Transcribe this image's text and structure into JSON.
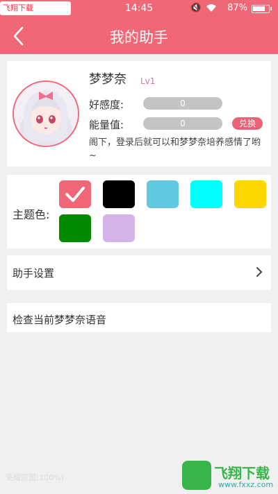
{
  "status_bar": {
    "watermark": "飞翔下载 www.FXXZ.com",
    "time": "14:45",
    "battery_percent": "87%",
    "battery_level": 0.87,
    "icons": [
      "mute-icon",
      "wifi-icon",
      "battery-icon"
    ]
  },
  "header": {
    "title": "我的助手",
    "back_icon": "chevron-left-icon"
  },
  "profile": {
    "name": "梦梦奈",
    "level": "Lv1",
    "favor_label": "好感度:",
    "favor_value": "0",
    "energy_label": "能量值:",
    "energy_value": "0",
    "exchange_label": "兑换",
    "intro": "阁下，登录后就可以和梦梦奈培养感情了哟~"
  },
  "theme": {
    "label": "主题色:",
    "selected_index": 0,
    "colors": [
      "#f06878",
      "#000000",
      "#62c8e0",
      "#00ffff",
      "#ffd700",
      "#008a00",
      "#d3b3e8"
    ]
  },
  "menu": {
    "assistant_settings": "助手设置",
    "check_voice": "检查当前梦梦奈语音",
    "chevron_icon": "chevron-right-icon"
  },
  "watermarks": {
    "bottom_left": "荣耀原图(100%)",
    "brand": "飞翔下载",
    "url": "www.fxxz.com"
  }
}
